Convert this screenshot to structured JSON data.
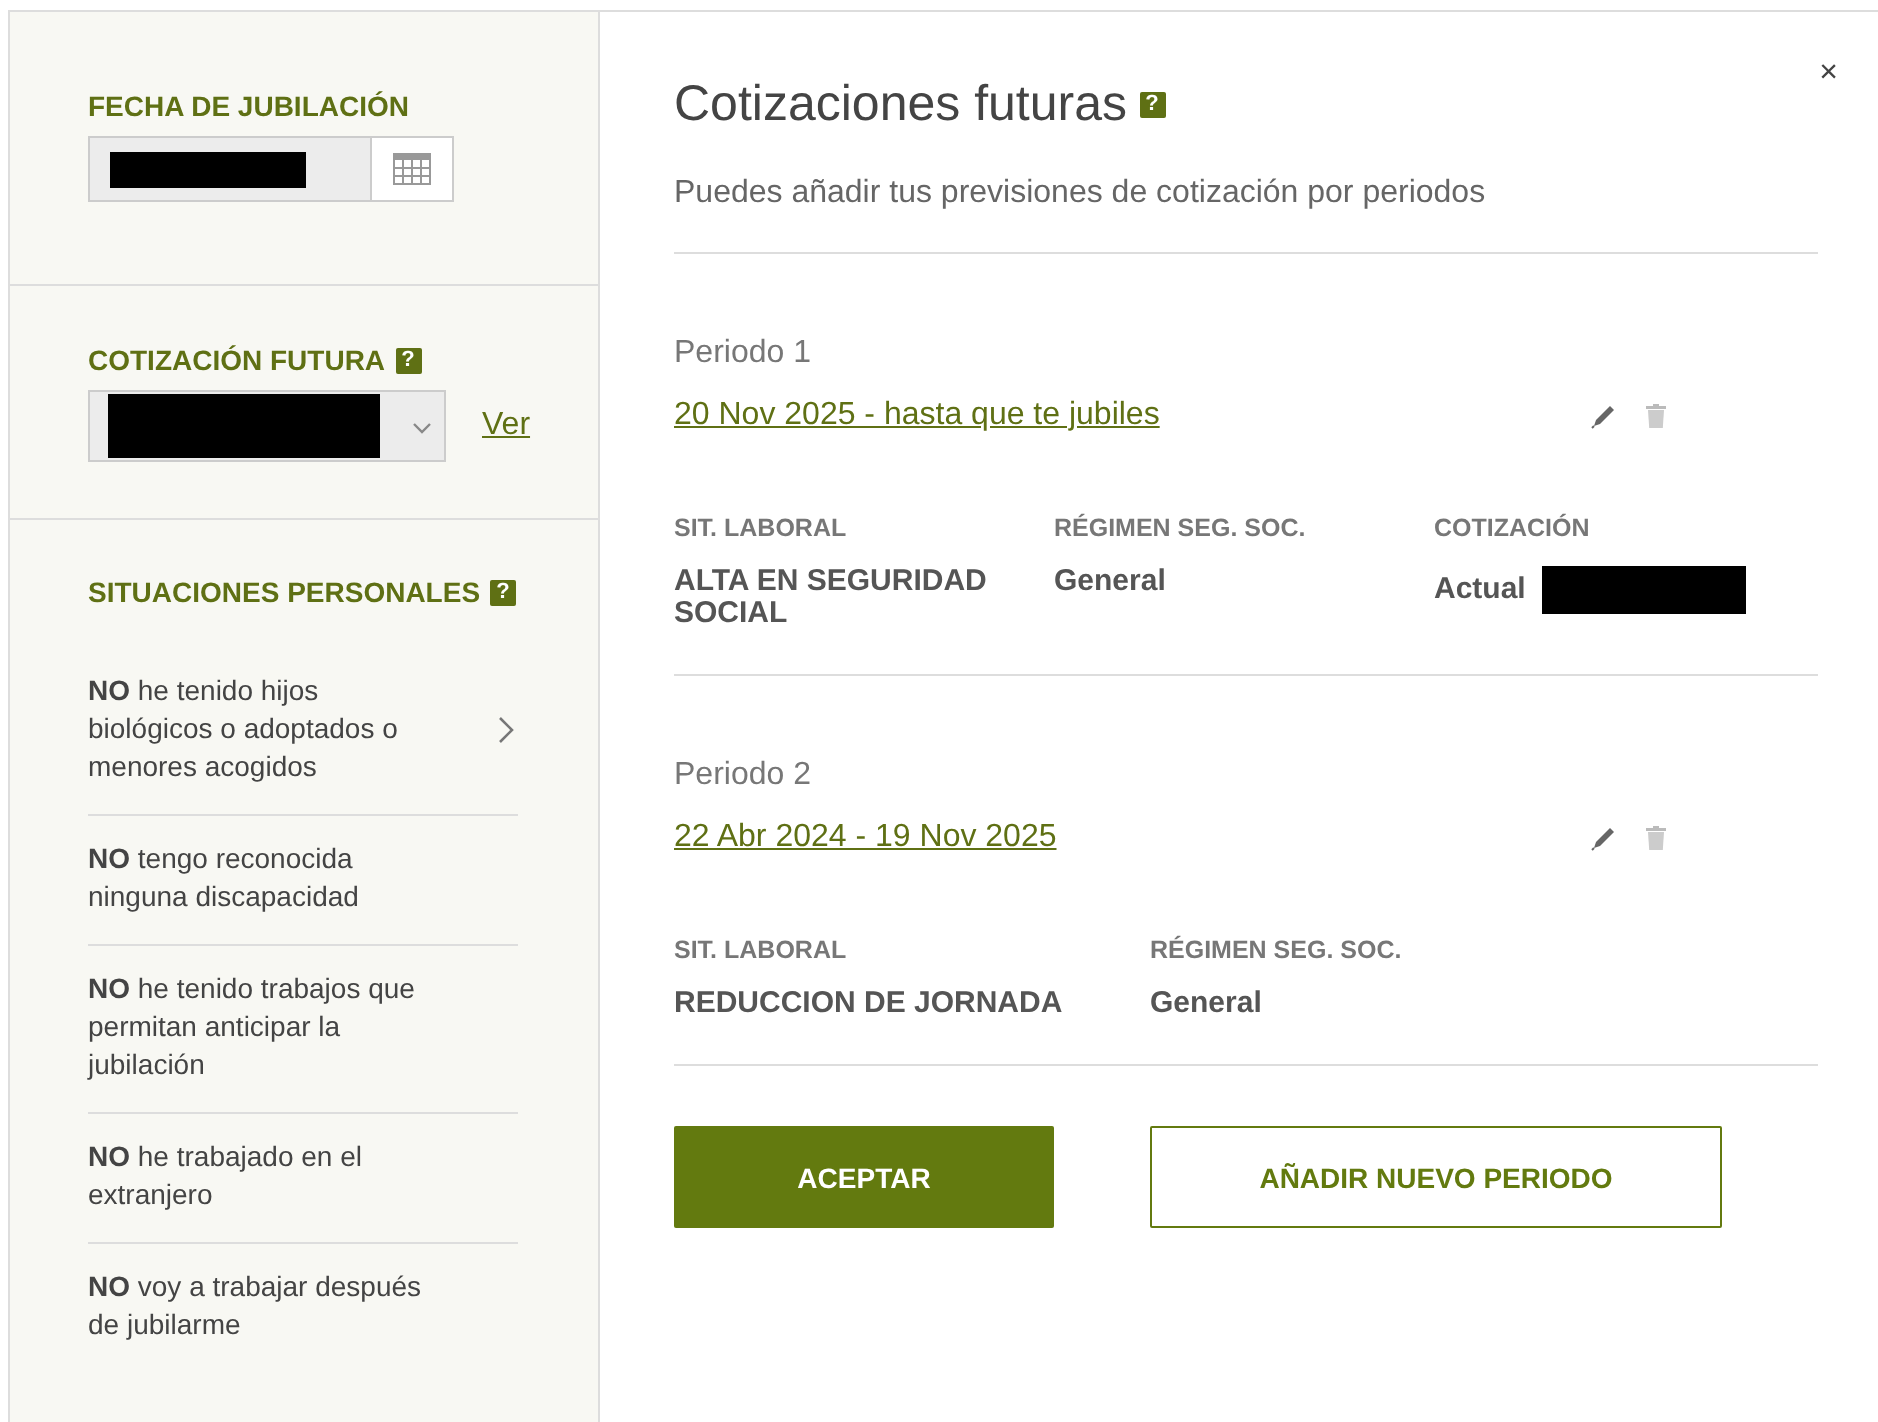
{
  "sidebar": {
    "retirement_date": {
      "label": "FECHA DE JUBILACIÓN",
      "value_redacted": true
    },
    "future_contribution": {
      "label": "COTIZACIÓN FUTURA",
      "help": "?",
      "value_redacted": true,
      "link": "Ver"
    },
    "personal_situations": {
      "label": "SITUACIONES PERSONALES",
      "help": "?",
      "items": [
        {
          "text": "**NO** he tenido hijos biológicos o adoptados o menores acogidos",
          "has_chevron": true
        },
        {
          "text": "**NO** tengo reconocida ninguna discapacidad",
          "has_chevron": false
        },
        {
          "text": "**NO** he tenido trabajos que permitan anticipar la jubilación",
          "has_chevron": false
        },
        {
          "text": "**NO** he trabajado en el extranjero",
          "has_chevron": false
        },
        {
          "text": "**NO** voy a trabajar después de jubilarme",
          "has_chevron": false
        }
      ]
    }
  },
  "dialog": {
    "close": "×",
    "title": "Cotizaciones futuras",
    "help": "?",
    "subtitle": "Puedes añadir tus previsiones de cotización por periodos",
    "periods": [
      {
        "title": "Periodo 1",
        "dates": "20 Nov 2025 - hasta que te jubiles",
        "fields": [
          {
            "label": "SIT. LABORAL",
            "value": "ALTA EN SEGURIDAD SOCIAL",
            "value_redacted": false
          },
          {
            "label": "RÉGIMEN SEG. SOC.",
            "value": "General",
            "value_redacted": false
          },
          {
            "label": "COTIZACIÓN",
            "value": "Actual",
            "value_redacted": true
          }
        ]
      },
      {
        "title": "Periodo 2",
        "dates": "22 Abr 2024 - 19 Nov 2025",
        "fields": [
          {
            "label": "SIT. LABORAL",
            "value": "REDUCCION DE JORNADA",
            "value_redacted": false
          },
          {
            "label": "RÉGIMEN SEG. SOC.",
            "value": "General",
            "value_redacted": false
          }
        ]
      }
    ],
    "buttons": [
      {
        "label": "ACEPTAR",
        "kind": "primary"
      },
      {
        "label": "AÑADIR NUEVO PERIODO",
        "kind": "secondary"
      }
    ]
  }
}
